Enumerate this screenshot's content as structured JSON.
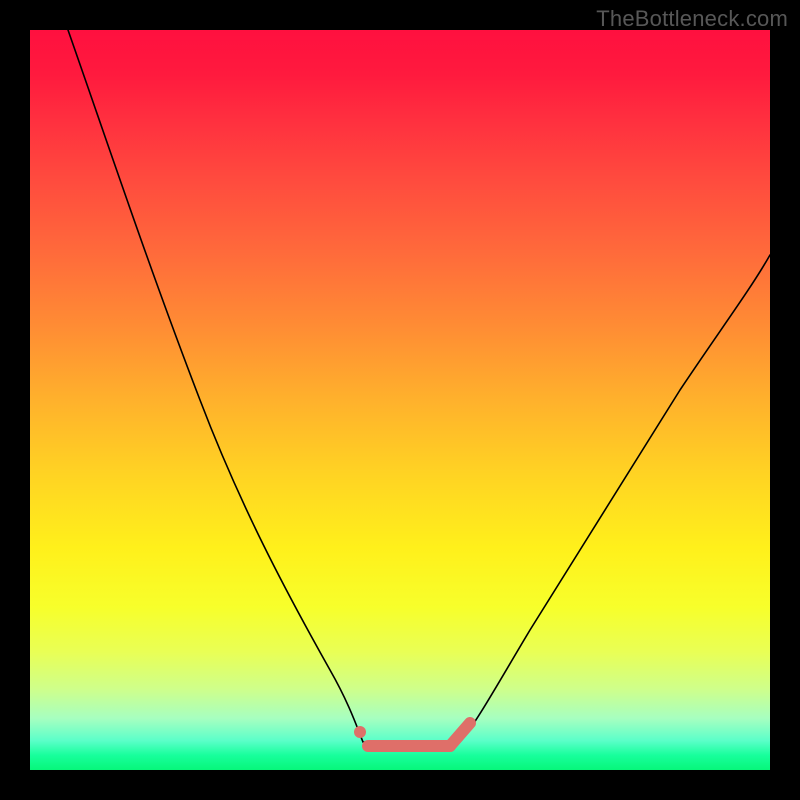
{
  "watermark": "TheBottleneck.com",
  "colors": {
    "background": "#000000",
    "gradient_top": "#ff103f",
    "gradient_bottom": "#07f77a",
    "curve": "#000000",
    "flat_marker": "#df6f69"
  },
  "chart_data": {
    "type": "line",
    "title": "",
    "xlabel": "",
    "ylabel": "",
    "xlim": [
      0,
      1
    ],
    "ylim": [
      0,
      1
    ],
    "x": [
      0.0,
      0.05,
      0.1,
      0.15,
      0.2,
      0.25,
      0.3,
      0.35,
      0.4,
      0.43,
      0.47,
      0.52,
      0.56,
      0.6,
      0.65,
      0.7,
      0.75,
      0.8,
      0.85,
      0.9,
      0.95,
      1.0
    ],
    "values": [
      1.0,
      0.93,
      0.84,
      0.74,
      0.62,
      0.5,
      0.38,
      0.26,
      0.14,
      0.07,
      0.02,
      0.0,
      0.0,
      0.03,
      0.08,
      0.14,
      0.22,
      0.31,
      0.4,
      0.49,
      0.59,
      0.7
    ],
    "flat_region": {
      "x_start": 0.44,
      "x_end": 0.59,
      "y": 0.03
    },
    "annotations": []
  }
}
